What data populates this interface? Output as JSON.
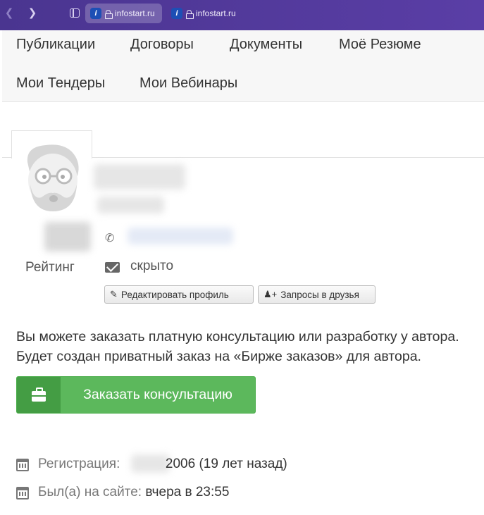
{
  "browser": {
    "tabs": [
      {
        "label": "infostart.ru",
        "active": true
      },
      {
        "label": "infostart.ru",
        "active": false
      }
    ],
    "favicon_letter": "i",
    "accent": "#5a3ea6"
  },
  "menu": {
    "items": [
      "Публикации",
      "Договоры",
      "Документы",
      "Моё Резюме",
      "Мои Тендеры",
      "Мои Вебинары"
    ]
  },
  "profile": {
    "rating_label": "Рейтинг",
    "email_value": "скрыто",
    "edit_button": "Редактировать профиль",
    "friends_button": "Запросы в друзья"
  },
  "consultation": {
    "line1": "Вы можете заказать платную консультацию или разработку у автора.",
    "line2": "Будет создан приватный заказ на «Бирже заказов» для автора.",
    "button": "Заказать консультацию",
    "button_color": "#5cb85c"
  },
  "info": {
    "registration_label": "Регистрация:",
    "registration_value": "2006 (19 лет назад)",
    "last_seen_label": "Был(а) на сайте:",
    "last_seen_value": "вчера в 23:55"
  }
}
